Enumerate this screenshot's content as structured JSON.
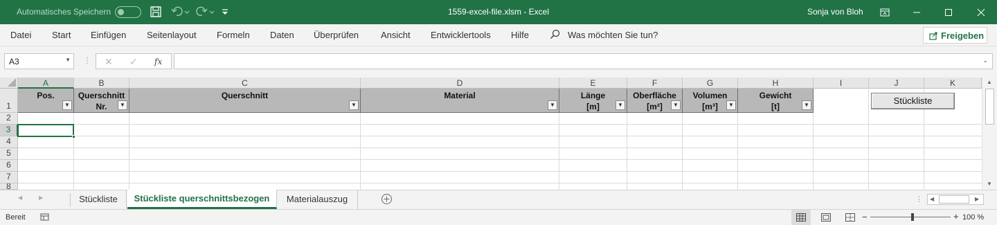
{
  "titlebar": {
    "autosave_label": "Automatisches Speichern",
    "file_title": "1559-excel-file.xlsm  -  Excel",
    "user": "Sonja von Bloh"
  },
  "menu": {
    "items": [
      "Datei",
      "Start",
      "Einfügen",
      "Seitenlayout",
      "Formeln",
      "Daten",
      "Überprüfen",
      "Ansicht",
      "Entwicklertools",
      "Hilfe"
    ],
    "search_placeholder": "Was möchten Sie tun?",
    "share_label": "Freigeben"
  },
  "formula_bar": {
    "name_box": "A3",
    "fx_label": "fx",
    "formula": ""
  },
  "grid": {
    "columns": [
      "A",
      "B",
      "C",
      "D",
      "E",
      "F",
      "G",
      "H",
      "I",
      "J",
      "K"
    ],
    "rows": [
      "1",
      "2",
      "3",
      "4",
      "5",
      "6",
      "7",
      "8"
    ],
    "selected_column": "A",
    "selected_row": "3",
    "headers": {
      "A": [
        "Pos.",
        ""
      ],
      "B": [
        "Querschnitt",
        "Nr."
      ],
      "C": [
        "Querschnitt",
        ""
      ],
      "D": [
        "Material",
        ""
      ],
      "E": [
        "Länge",
        "[m]"
      ],
      "F": [
        "Oberfläche",
        "[m²]"
      ],
      "G": [
        "Volumen",
        "[m³]"
      ],
      "H": [
        "Gewicht",
        "[t]"
      ]
    },
    "button_label": "Stückliste"
  },
  "sheets": {
    "tabs": [
      "Stückliste",
      "Stückliste querschnittsbezogen",
      "Materialauszug"
    ],
    "active": "Stückliste querschnittsbezogen"
  },
  "status": {
    "ready": "Bereit",
    "zoom": "100 %"
  },
  "colors": {
    "accent": "#217346",
    "header_fill": "#b8b8b8"
  }
}
